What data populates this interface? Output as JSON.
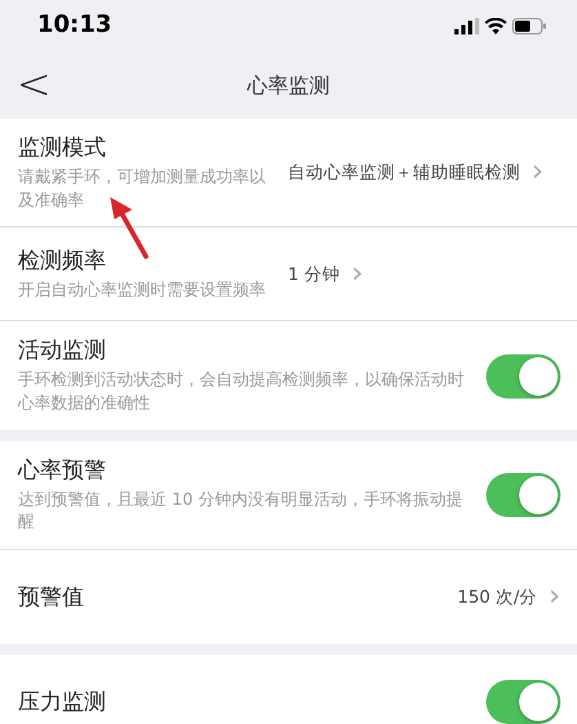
{
  "status_bar": {
    "time": "10:13"
  },
  "nav_bar": {
    "back": "<",
    "title": "心率监测"
  },
  "sections": [
    {
      "rows": [
        {
          "kind": "link",
          "title": "监测模式",
          "subtitle": "请戴紧手环，可增加测量成功率以及准确率",
          "value": "自动心率监测＋辅助睡眠检测",
          "chevron": "›"
        },
        {
          "kind": "link",
          "title": "检测频率",
          "subtitle": "开启自动心率监测时需要设置频率",
          "value": "1 分钟",
          "chevron": "›"
        },
        {
          "kind": "toggle",
          "title": "活动监测",
          "subtitle": "手环检测到活动状态时，会自动提高检测频率，以确保活动时心率数据的准确性",
          "on": true
        }
      ]
    },
    {
      "rows": [
        {
          "kind": "toggle",
          "title": "心率预警",
          "subtitle": "达到预警值，且最近 10 分钟内没有明显活动，手环将振动提醒",
          "on": true
        },
        {
          "kind": "link",
          "title": "预警值",
          "value": "150 次/分",
          "chevron": "›"
        }
      ]
    },
    {
      "rows": [
        {
          "kind": "toggle",
          "title": "压力监测",
          "on": true
        }
      ]
    }
  ]
}
